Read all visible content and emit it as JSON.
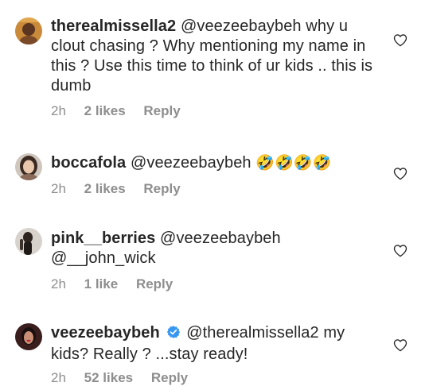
{
  "comments": [
    {
      "username": "therealmissella2",
      "text": "@veezeebaybeh why u clout chasing ? Why mentioning my name in this ? Use this time to think of ur kids .. this is dumb",
      "emoji": "",
      "time": "2h",
      "likes": "2 likes",
      "reply": "Reply"
    },
    {
      "username": "boccafola",
      "text": "@veezeebaybeh",
      "emoji": "🤣🤣🤣🤣",
      "time": "2h",
      "likes": "2 likes",
      "reply": "Reply"
    },
    {
      "username": "pink__berries",
      "text": "@veezeebaybeh @__john_wick",
      "emoji": "",
      "time": "2h",
      "likes": "1 like",
      "reply": "Reply"
    },
    {
      "username": "veezeebaybeh",
      "text": "@therealmissella2 my kids? Really ? ...stay ready!",
      "emoji": "",
      "verified": true,
      "time": "2h",
      "likes": "52 likes",
      "reply": "Reply"
    }
  ],
  "colors": {
    "text": "#262626",
    "meta": "#8e8e8e",
    "verified": "#3897f0"
  }
}
